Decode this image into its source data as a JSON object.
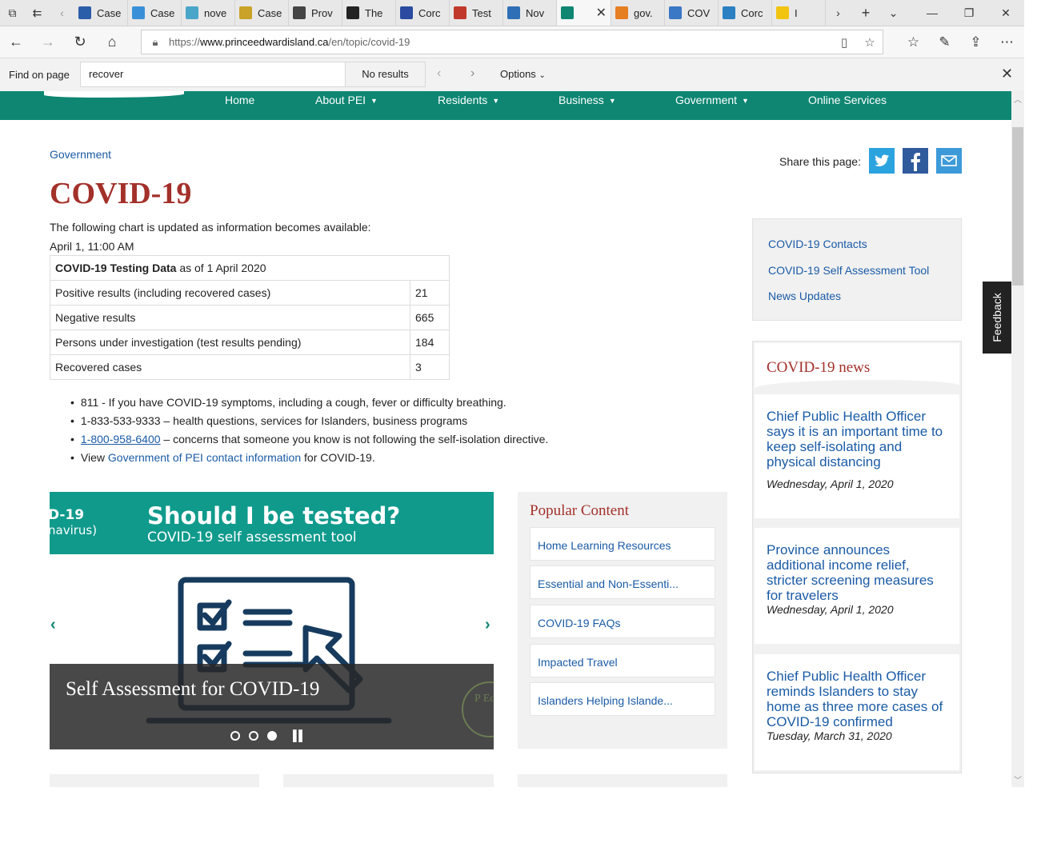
{
  "browser": {
    "tabs": [
      {
        "title": "Case",
        "color": "#2b5ea8"
      },
      {
        "title": "Case",
        "color": "#3a90d8"
      },
      {
        "title": "nove",
        "color": "#4aa6c8"
      },
      {
        "title": "Case",
        "color": "#c9a227"
      },
      {
        "title": "Prov",
        "color": "#444444"
      },
      {
        "title": "The",
        "color": "#222222"
      },
      {
        "title": "Corc",
        "color": "#2a4ba0"
      },
      {
        "title": "Test",
        "color": "#c0392b"
      },
      {
        "title": "Nov",
        "color": "#2e6fb5"
      },
      {
        "title": "",
        "color": "#0e8672",
        "active": true
      },
      {
        "title": "gov.",
        "color": "#e67e22"
      },
      {
        "title": "COV",
        "color": "#3a77c4"
      },
      {
        "title": "Corc",
        "color": "#2a80c0"
      },
      {
        "title": "I",
        "color": "#f1c40f"
      }
    ],
    "url_prefix": "https://",
    "url_domain": "www.princeedwardisland.ca",
    "url_path": "/en/topic/covid-19",
    "find": {
      "label": "Find on page",
      "query": "recover",
      "result": "No results",
      "options": "Options"
    }
  },
  "nav": {
    "items": [
      {
        "label": "Home",
        "caret": false
      },
      {
        "label": "About PEI",
        "caret": true
      },
      {
        "label": "Residents",
        "caret": true
      },
      {
        "label": "Business",
        "caret": true
      },
      {
        "label": "Government",
        "caret": true
      },
      {
        "label": "Online Services",
        "caret": false
      }
    ]
  },
  "page": {
    "breadcrumb": "Government",
    "title": "COVID-19",
    "intro": "The following chart is updated as information becomes available:",
    "date": "April 1, 11:00 AM",
    "table": {
      "header_bold": "COVID-19 Testing Data",
      "header_rest": " as of 1 April 2020",
      "rows": [
        {
          "label": "Positive results (including recovered cases)",
          "value": "21"
        },
        {
          "label": "Negative results",
          "value": "665"
        },
        {
          "label": "Persons under investigation (test results pending)",
          "value": "184"
        },
        {
          "label": "Recovered cases",
          "value": "3"
        }
      ]
    },
    "bullets": {
      "b1": "811 - If you have COVID-19 symptoms, including a cough, fever or difficulty breathing.",
      "b2": "1-833-533-9333 – health questions, services for Islanders, business programs",
      "b3_link": "1-800-958-6400",
      "b3_rest": " – concerns that someone you know is not following the self-isolation directive.",
      "b4_pre": "View ",
      "b4_link": "Government of PEI contact information",
      "b4_post": " for COVID-19."
    },
    "share_label": "Share this page:",
    "quick_links": [
      "COVID-19 Contacts",
      "COVID-19 Self Assessment Tool",
      "News Updates"
    ],
    "feedback": "Feedback",
    "news": {
      "title": "COVID-19 news",
      "items": [
        {
          "headline": "Chief Public Health Officer says it is an important time to keep self-isolating and physical distancing",
          "date": "Wednesday, April 1, 2020"
        },
        {
          "headline": "Province announces additional income relief, stricter screening measures for travelers",
          "date": "Wednesday, April 1, 2020"
        },
        {
          "headline": "Chief Public Health Officer reminds Islanders to stay home as three more cases of COVID-19 confirmed",
          "date": "Tuesday, March 31, 2020"
        }
      ]
    },
    "slider": {
      "banner_left_1": "D-19",
      "banner_left_2": "navirus)",
      "banner_headline": "Should I be tested?",
      "banner_sub": "COVID-19 self assessment tool",
      "caption": "Self Assessment for COVID-19",
      "seal_text": "P Ed"
    },
    "popular": {
      "title": "Popular Content",
      "items": [
        "Home Learning Resources",
        "Essential and Non-Essenti...",
        "COVID-19 FAQs",
        "Impacted Travel",
        "Islanders Helping Islande..."
      ]
    }
  }
}
